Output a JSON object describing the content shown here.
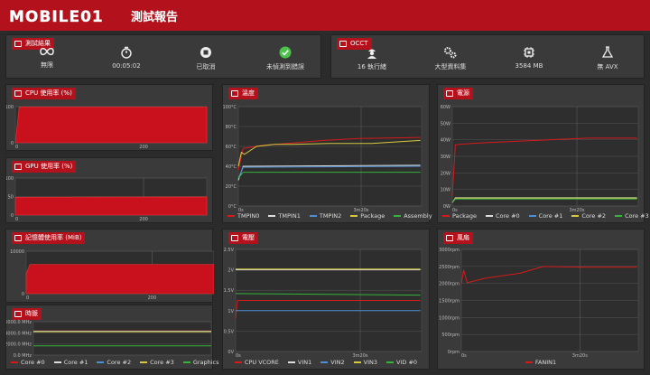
{
  "header": {
    "logo_text": "MOBILE01",
    "title": "測試報告"
  },
  "results": {
    "title": "測試結果",
    "items": [
      {
        "icon": "infinity-icon",
        "value": "無限"
      },
      {
        "icon": "stopwatch-icon",
        "value": "00:05:02"
      },
      {
        "icon": "stop-icon",
        "value": "已取消"
      },
      {
        "icon": "check-icon",
        "value": "未偵測到錯誤"
      }
    ]
  },
  "occt": {
    "title": "OCCT",
    "items": [
      {
        "icon": "worker-icon",
        "value": "16 執行緒"
      },
      {
        "icon": "gears-icon",
        "value": "大型資料集"
      },
      {
        "icon": "chip-icon",
        "value": "3584 MB"
      },
      {
        "icon": "flask-icon",
        "value": "無 AVX"
      }
    ]
  },
  "colors": {
    "accent": "#b3111c",
    "panel": "#3a3a3a",
    "background": "#2b2b2b"
  },
  "chart_data": [
    {
      "id": "cpu",
      "title": "CPU 使用率 (%)",
      "type": "area",
      "yticks": [
        "0",
        "100"
      ],
      "xticks": [
        "0",
        "200"
      ],
      "ylim": [
        0,
        100
      ],
      "series": [
        {
          "color": "#c8111c",
          "values": [
            [
              0,
              0
            ],
            [
              6,
              99
            ],
            [
              302,
              99
            ]
          ]
        }
      ]
    },
    {
      "id": "gpu",
      "title": "GPU 使用率 (%)",
      "type": "area",
      "yticks": [
        "0",
        "50",
        "100"
      ],
      "xticks": [
        "0",
        "200"
      ],
      "ylim": [
        0,
        100
      ],
      "series": [
        {
          "color": "#c8111c",
          "values": [
            [
              0,
              48
            ],
            [
              302,
              49
            ]
          ]
        }
      ]
    },
    {
      "id": "mem",
      "title": "記憶體使用率 (MiB)",
      "type": "area",
      "yticks": [
        "0",
        "10000"
      ],
      "xticks": [
        "0",
        "200"
      ],
      "ylim": [
        0,
        16000
      ],
      "series": [
        {
          "color": "#c8111c",
          "values": [
            [
              0,
              7500
            ],
            [
              6,
              11000
            ],
            [
              302,
              11000
            ]
          ]
        }
      ]
    },
    {
      "id": "clock",
      "title": "時脈",
      "type": "line",
      "yticks": [
        "0.0 MHz",
        "2000.0 MHz",
        "4000.0 MHz",
        "6000.0 MHz"
      ],
      "xticks": [],
      "ylim": [
        0,
        6500
      ],
      "series": [
        {
          "name": "Core #0",
          "color": "#d61a1a",
          "values": [
            [
              0,
              4700
            ],
            [
              302,
              4700
            ]
          ]
        },
        {
          "name": "Core #1",
          "color": "#dddddd",
          "values": [
            [
              0,
              4650
            ],
            [
              302,
              4650
            ]
          ]
        },
        {
          "name": "Core #2",
          "color": "#4d8fd6",
          "values": [
            [
              0,
              4600
            ],
            [
              302,
              4600
            ]
          ]
        },
        {
          "name": "Core #3",
          "color": "#d6c93f",
          "values": [
            [
              0,
              4550
            ],
            [
              302,
              4550
            ]
          ]
        },
        {
          "name": "Graphics",
          "color": "#35b33a",
          "values": [
            [
              0,
              1800
            ],
            [
              302,
              1800
            ]
          ]
        }
      ]
    },
    {
      "id": "temp",
      "title": "溫度",
      "type": "line",
      "yticks": [
        "0°C",
        "20°C",
        "40°C",
        "60°C",
        "80°C",
        "100°C"
      ],
      "xticks": [
        "0s",
        "3m20s"
      ],
      "ylim": [
        0,
        100
      ],
      "series": [
        {
          "name": "TMPIN0",
          "color": "#d61a1a",
          "values": [
            [
              0,
              36
            ],
            [
              8,
              58
            ],
            [
              40,
              61
            ],
            [
              80,
              63
            ],
            [
              140,
              66
            ],
            [
              200,
              68
            ],
            [
              300,
              69
            ]
          ]
        },
        {
          "name": "TMPIN1",
          "color": "#dddddd",
          "values": [
            [
              0,
              26
            ],
            [
              8,
              40
            ],
            [
              300,
              41
            ]
          ]
        },
        {
          "name": "TMPIN2",
          "color": "#4d8fd6",
          "values": [
            [
              0,
              28
            ],
            [
              8,
              39
            ],
            [
              300,
              40
            ]
          ]
        },
        {
          "name": "Package",
          "color": "#d6c93f",
          "values": [
            [
              0,
              40
            ],
            [
              5,
              54
            ],
            [
              10,
              52
            ],
            [
              30,
              60
            ],
            [
              60,
              62
            ],
            [
              90,
              62
            ],
            [
              150,
              63
            ],
            [
              220,
              63
            ],
            [
              300,
              66
            ]
          ]
        },
        {
          "name": "Assembly",
          "color": "#35b33a",
          "values": [
            [
              0,
              28
            ],
            [
              8,
              34
            ],
            [
              300,
              34
            ]
          ]
        }
      ]
    },
    {
      "id": "voltage",
      "title": "電壓",
      "type": "line",
      "yticks": [
        "0V",
        "0.5V",
        "1V",
        "1.5V",
        "2V",
        "2.5V"
      ],
      "xticks": [
        "0s",
        "3m20s"
      ],
      "ylim": [
        0,
        2.5
      ],
      "series": [
        {
          "name": "CPU VCORE",
          "color": "#d61a1a",
          "values": [
            [
              0,
              0.8
            ],
            [
              3,
              1.25
            ],
            [
              300,
              1.25
            ]
          ]
        },
        {
          "name": "VIN1",
          "color": "#dddddd",
          "values": [
            [
              0,
              2.0
            ],
            [
              300,
              2.0
            ]
          ]
        },
        {
          "name": "VIN2",
          "color": "#4d8fd6",
          "values": [
            [
              0,
              1.0
            ],
            [
              300,
              1.0
            ]
          ]
        },
        {
          "name": "VIN3",
          "color": "#d6c93f",
          "values": [
            [
              0,
              2.02
            ],
            [
              300,
              2.02
            ]
          ]
        },
        {
          "name": "VID #0",
          "color": "#35b33a",
          "values": [
            [
              0,
              1.42
            ],
            [
              300,
              1.38
            ]
          ]
        }
      ]
    },
    {
      "id": "power",
      "title": "電源",
      "type": "line",
      "yticks": [
        "0W",
        "10W",
        "20W",
        "30W",
        "40W",
        "50W",
        "60W"
      ],
      "xticks": [
        "0s",
        "3m20s"
      ],
      "ylim": [
        0,
        60
      ],
      "series": [
        {
          "name": "Package",
          "color": "#d61a1a",
          "values": [
            [
              0,
              6
            ],
            [
              5,
              37
            ],
            [
              40,
              38
            ],
            [
              100,
              39
            ],
            [
              160,
              40
            ],
            [
              220,
              41
            ],
            [
              300,
              41
            ]
          ]
        },
        {
          "name": "Core #0",
          "color": "#dddddd",
          "values": [
            [
              0,
              2
            ],
            [
              5,
              5
            ],
            [
              300,
              5
            ]
          ]
        },
        {
          "name": "Core #1",
          "color": "#4d8fd6",
          "values": [
            [
              0,
              2
            ],
            [
              5,
              4.5
            ],
            [
              300,
              4.5
            ]
          ]
        },
        {
          "name": "Core #2",
          "color": "#d6c93f",
          "values": [
            [
              0,
              2
            ],
            [
              5,
              4.8
            ],
            [
              300,
              4.8
            ]
          ]
        },
        {
          "name": "Core #3",
          "color": "#35b33a",
          "values": [
            [
              0,
              2
            ],
            [
              5,
              4.2
            ],
            [
              300,
              4.2
            ]
          ]
        }
      ]
    },
    {
      "id": "fan",
      "title": "風扇",
      "type": "line",
      "yticks": [
        "0rpm",
        "500rpm",
        "1000rpm",
        "1500rpm",
        "2000rpm",
        "2500rpm",
        "3000rpm"
      ],
      "xticks": [
        "0s",
        "3m20s"
      ],
      "ylim": [
        0,
        3000
      ],
      "series": [
        {
          "name": "FANIN1",
          "color": "#d61a1a",
          "values": [
            [
              0,
              1980
            ],
            [
              4,
              2400
            ],
            [
              10,
              2020
            ],
            [
              40,
              2150
            ],
            [
              100,
              2300
            ],
            [
              140,
              2500
            ],
            [
              200,
              2480
            ],
            [
              300,
              2480
            ]
          ]
        }
      ]
    }
  ]
}
